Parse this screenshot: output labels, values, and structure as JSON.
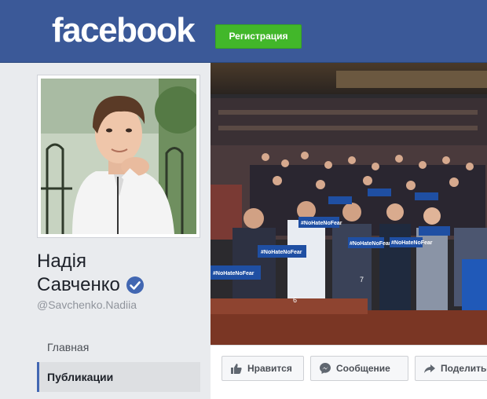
{
  "header": {
    "logo_text": "facebook",
    "register_label": "Регистрация",
    "bg_color": "#3b5998",
    "register_color": "#42b72a"
  },
  "profile": {
    "name_line1": "Надія",
    "name_line2": "Савченко",
    "verified_icon": "verified-badge-icon",
    "username": "@Savchenko.Nadiia"
  },
  "nav": {
    "items": [
      {
        "label": "Главная",
        "active": false
      },
      {
        "label": "Публикации",
        "active": true
      }
    ]
  },
  "cover": {
    "sign_text": "#NoHateNoFear",
    "seat_numbers": [
      "6",
      "7"
    ]
  },
  "actions": {
    "like_label": "Нравится",
    "message_label": "Сообщение",
    "share_label": "Поделиться",
    "like_icon": "thumbs-up-icon",
    "message_icon": "messenger-icon",
    "share_icon": "share-arrow-icon"
  }
}
